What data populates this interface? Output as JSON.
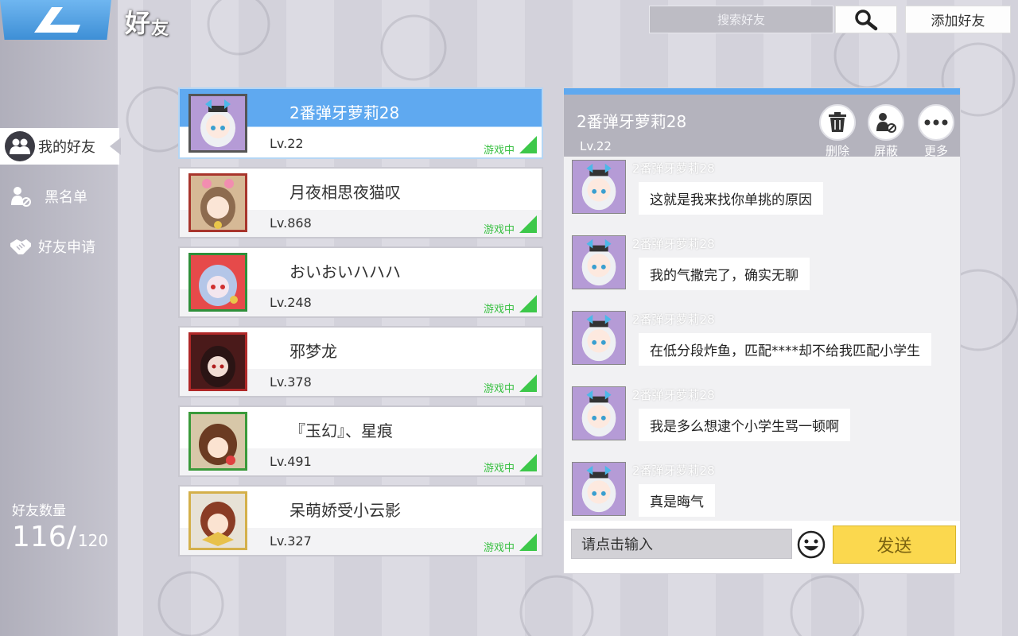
{
  "header": {
    "title_main": "好",
    "title_sub": "友",
    "search_placeholder": "搜索好友",
    "add_friend_label": "添加好友"
  },
  "sidebar": {
    "items": [
      {
        "label": "我的好友",
        "icon": "friends-icon",
        "active": true
      },
      {
        "label": "黑名单",
        "icon": "blocked-user-icon",
        "active": false
      },
      {
        "label": "好友申请",
        "icon": "handshake-icon",
        "active": false
      }
    ],
    "friend_count_label": "好友数量",
    "friend_count_current": "116/",
    "friend_count_max": "120"
  },
  "friends": [
    {
      "name": "2番弹牙萝莉28",
      "level": "Lv.22",
      "status": "游戏中",
      "selected": true
    },
    {
      "name": "月夜相思夜猫叹",
      "level": "Lv.868",
      "status": "游戏中",
      "selected": false
    },
    {
      "name": "おいおいハハハ",
      "level": "Lv.248",
      "status": "游戏中",
      "selected": false
    },
    {
      "name": "邪梦龙",
      "level": "Lv.378",
      "status": "游戏中",
      "selected": false
    },
    {
      "name": "『玉幻』、星痕",
      "level": "Lv.491",
      "status": "游戏中",
      "selected": false
    },
    {
      "name": "呆萌娇受小云影",
      "level": "Lv.327",
      "status": "游戏中",
      "selected": false
    }
  ],
  "chat": {
    "name": "2番弹牙萝莉28",
    "level": "Lv.22",
    "actions": [
      {
        "label": "删除",
        "icon": "trash-icon"
      },
      {
        "label": "屏蔽",
        "icon": "block-user-icon"
      },
      {
        "label": "更多",
        "icon": "more-icon"
      }
    ],
    "messages": [
      {
        "sender": "2番弹牙萝莉28",
        "text": "这就是我来找你单挑的原因"
      },
      {
        "sender": "2番弹牙萝莉28",
        "text": "我的气撒完了，确实无聊"
      },
      {
        "sender": "2番弹牙萝莉28",
        "text": "在低分段炸鱼，匹配****却不给我匹配小学生"
      },
      {
        "sender": "2番弹牙萝莉28",
        "text": "我是多么想逮个小学生骂一顿啊"
      },
      {
        "sender": "2番弹牙萝莉28",
        "text": "真是晦气"
      }
    ],
    "input_placeholder": "请点击输入",
    "send_label": "发送"
  },
  "colors": {
    "accent_blue": "#5fa9f0",
    "online_green": "#39c042",
    "send_yellow": "#fbd84e"
  }
}
